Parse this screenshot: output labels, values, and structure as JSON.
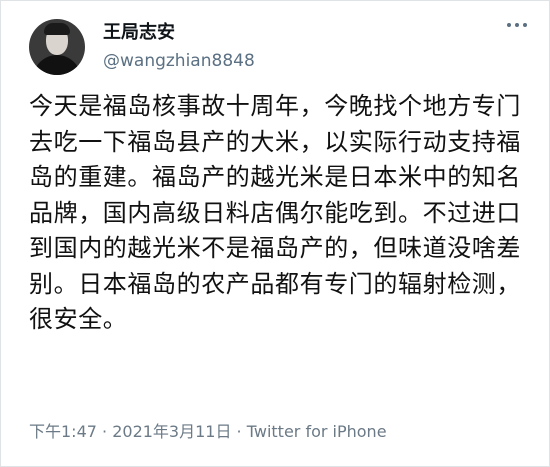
{
  "tweet": {
    "display_name": "王局志安",
    "handle": "@wangzhian8848",
    "avatar": "profile-photo",
    "body_text": "今天是福岛核事故十周年，今晚找个地方专门去吃一下福岛县产的大米，以实际行动支持福岛的重建。福岛产的越光米是日本米中的知名品牌，国内高级日料店偶尔能吃到。不过进口到国内的越光米不是福岛产的，但味道没啥差别。日本福岛的农产品都有专门的辐射检测，很安全。",
    "time": "下午1:47",
    "separator": " · ",
    "date": "2021年3月11日",
    "source": "Twitter for iPhone"
  },
  "icons": {
    "more_icon": "more-horizontal-icon"
  },
  "colors": {
    "text": "#0f1419",
    "secondary": "#5b7083",
    "border": "#dfe3e6"
  }
}
